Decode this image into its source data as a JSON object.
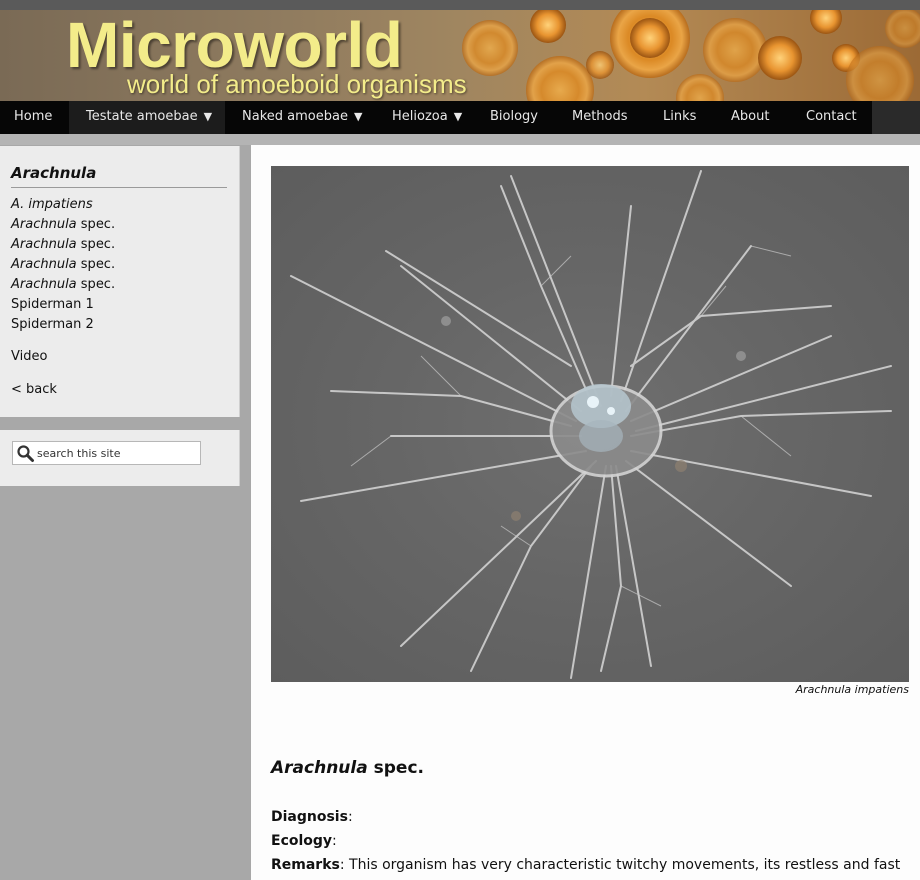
{
  "site": {
    "title": "Microworld",
    "subtitle": "world of amoeboid organisms"
  },
  "nav": {
    "items": [
      {
        "label": "Home",
        "has_submenu": false
      },
      {
        "label": "Testate amoebae",
        "has_submenu": true
      },
      {
        "label": "Naked amoebae",
        "has_submenu": true
      },
      {
        "label": "Heliozoa",
        "has_submenu": true
      },
      {
        "label": "Biology",
        "has_submenu": false
      },
      {
        "label": "Methods",
        "has_submenu": false
      },
      {
        "label": "Links",
        "has_submenu": false
      },
      {
        "label": "About",
        "has_submenu": false
      },
      {
        "label": "Contact",
        "has_submenu": false
      }
    ],
    "submenu_arrow": "▼"
  },
  "sidebar": {
    "title": "Arachnula",
    "links": [
      {
        "italic": "A. impatiens",
        "rest": ""
      },
      {
        "italic": "Arachnula",
        "rest": " spec."
      },
      {
        "italic": "Arachnula",
        "rest": " spec."
      },
      {
        "italic": "Arachnula",
        "rest": " spec."
      },
      {
        "italic": "Arachnula",
        "rest": " spec."
      },
      {
        "italic": "",
        "rest": "Spiderman 1"
      },
      {
        "italic": "",
        "rest": "Spiderman 2"
      }
    ],
    "video_label": "Video",
    "back_label": "< back"
  },
  "search": {
    "placeholder": "search this site",
    "icon": "search-icon"
  },
  "main": {
    "photo_caption": "Arachnula impatiens",
    "heading_italic": "Arachnula",
    "heading_rest": " spec.",
    "fields": [
      {
        "label": "Diagnosis",
        "text": ":"
      },
      {
        "label": "Ecology",
        "text": ":"
      },
      {
        "label": "Remarks",
        "text": ": This organism has very characteristic twitchy movements, its restless and fast"
      }
    ]
  },
  "colors": {
    "nav_bg": "#060606",
    "title_yellow": "#f3ec8a",
    "sidebar_bg": "#ececec",
    "page_bg": "#a8a8a8"
  }
}
